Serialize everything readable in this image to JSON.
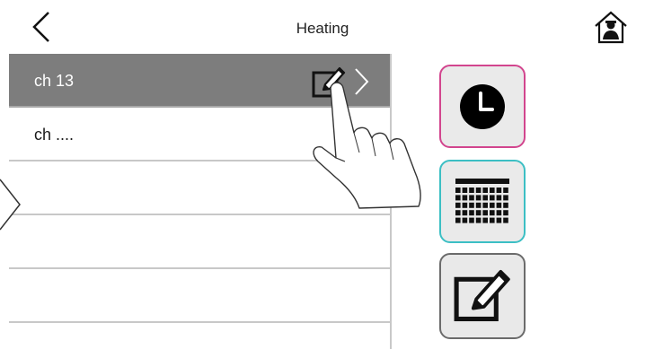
{
  "header": {
    "title": "Heating",
    "back_icon": "chevron-left-icon",
    "home_icon": "home-person-icon"
  },
  "list": {
    "rows": [
      {
        "label": "ch 13",
        "selected": true
      },
      {
        "label": "ch ...."
      },
      {
        "label": ""
      },
      {
        "label": ""
      },
      {
        "label": ""
      }
    ]
  },
  "side_buttons": [
    {
      "icon": "clock-icon",
      "accent": "#d2458e"
    },
    {
      "icon": "calendar-grid-icon",
      "accent": "#3cbfc4"
    },
    {
      "icon": "edit-icon",
      "accent": "#6b6b6b"
    }
  ],
  "colors": {
    "selected_row": "#7d7d7d",
    "divider": "#c8c8c8"
  }
}
